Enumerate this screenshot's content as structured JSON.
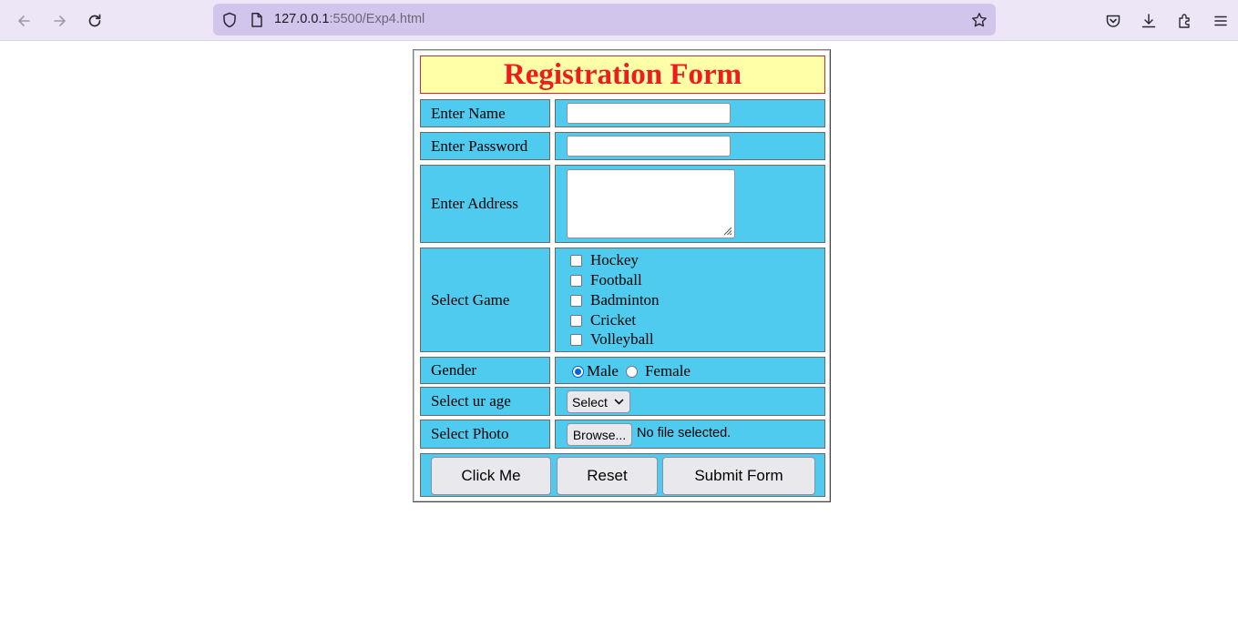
{
  "browser": {
    "url_host": "127.0.0.1",
    "url_rest": ":5500/Exp4.html"
  },
  "form": {
    "title": "Registration Form",
    "name_label": "Enter Name",
    "name_value": "",
    "password_label": "Enter Password",
    "password_value": "",
    "address_label": "Enter Address",
    "address_value": "",
    "game_label": "Select Game",
    "games": [
      "Hockey",
      "Football",
      "Badminton",
      "Cricket",
      "Volleyball"
    ],
    "gender_label": "Gender",
    "gender_options": [
      "Male",
      "Female"
    ],
    "gender_selected": "Male",
    "age_label": "Select ur age",
    "age_selected": "Select",
    "photo_label": "Select Photo",
    "browse_label": "Browse...",
    "file_status": "No file selected.",
    "buttons": {
      "click_me": "Click Me",
      "reset": "Reset",
      "submit": "Submit Form"
    }
  },
  "colors": {
    "cell_bg": "#4ecbee",
    "title_bg": "#ffffa8",
    "title_text": "#ee1c1c",
    "toolbar_bg": "#ede6f7",
    "urlbar_bg": "#d2c5ec"
  }
}
